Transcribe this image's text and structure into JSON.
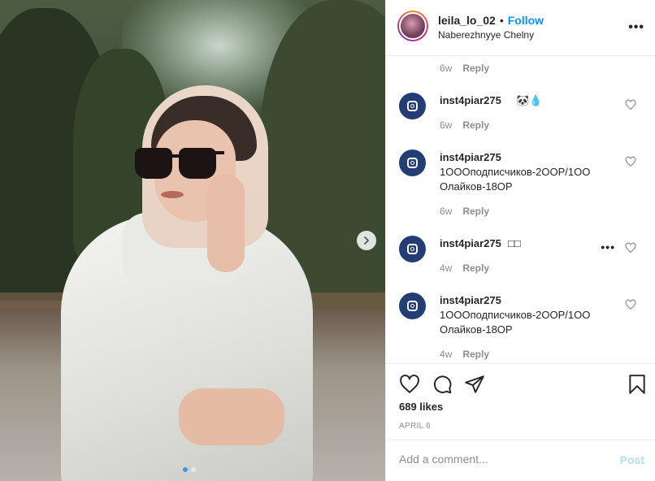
{
  "post": {
    "username": "leila_lo_02",
    "separator": "•",
    "follow_label": "Follow",
    "location": "Naberezhnyye Chelny",
    "more_label": "•••",
    "likes": "689 likes",
    "date": "APRIL 6"
  },
  "comments": [
    {
      "username": "",
      "text": "",
      "time": "6w",
      "reply": "Reply"
    },
    {
      "username": "inst4piar275",
      "text": "🐼💧",
      "time": "6w",
      "reply": "Reply"
    },
    {
      "username": "inst4piar275",
      "text": "1OOOподписчиков-2OOР/1OO Олайков-18OР",
      "time": "6w",
      "reply": "Reply"
    },
    {
      "username": "inst4piar275",
      "text": "□□",
      "time": "4w",
      "reply": "Reply",
      "more": "•••"
    },
    {
      "username": "inst4piar275",
      "text": "1OOOподписчиков-2OOР/1OO Олайков-18OР",
      "time": "4w",
      "reply": "Reply"
    }
  ],
  "composer": {
    "placeholder": "Add a comment...",
    "post_label": "Post"
  },
  "icons": {
    "like": "heart-icon",
    "comment": "comment-icon",
    "share": "paper-plane-icon",
    "save": "bookmark-icon",
    "next": "chevron-right-icon"
  },
  "colors": {
    "follow": "#0095f6",
    "post_disabled": "#b2dffc",
    "avatar_bg": "#233d75",
    "carousel_active": "#3897f0"
  },
  "carousel": {
    "current": 1,
    "total": 2
  }
}
